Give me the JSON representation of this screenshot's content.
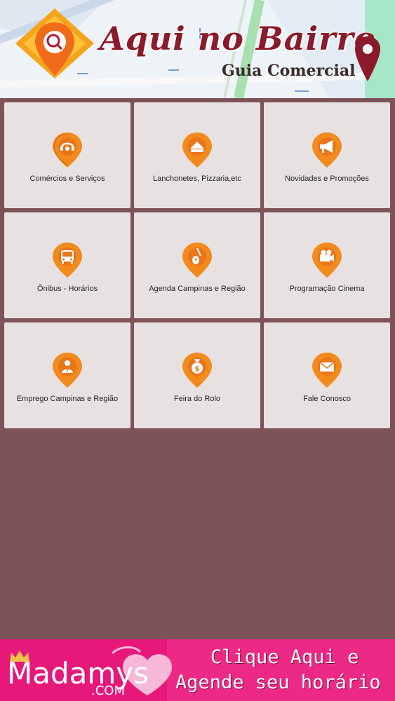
{
  "header": {
    "title": "Aqui no Bairro",
    "subtitle": "Guia Comercial"
  },
  "colors": {
    "pin": "#f28a1c",
    "tile_bg": "#e8e1e2",
    "page_bg": "#7d5358",
    "ad_bg": "#e6197a"
  },
  "categories": [
    {
      "label": "Comércios e Serviços",
      "icon": "headset-icon"
    },
    {
      "label": "Lanchonetes, Pizzaria,etc",
      "icon": "food-icon"
    },
    {
      "label": "Novidades e Promoções",
      "icon": "megaphone-icon"
    },
    {
      "label": "Ônibus - Horários",
      "icon": "bus-icon"
    },
    {
      "label": "Agenda Campinas e Região",
      "icon": "guitar-icon"
    },
    {
      "label": "Programação Cinema",
      "icon": "camera-icon"
    },
    {
      "label": "Emprego Campinas e Região",
      "icon": "worker-icon"
    },
    {
      "label": "Feira do Rolo",
      "icon": "money-bag-icon"
    },
    {
      "label": "Fale Conosco",
      "icon": "envelope-icon"
    }
  ],
  "ad": {
    "brand": "Madamys",
    "brand_domain": ".COM",
    "line1": "Clique Aqui e",
    "line2": "Agende seu horário"
  }
}
